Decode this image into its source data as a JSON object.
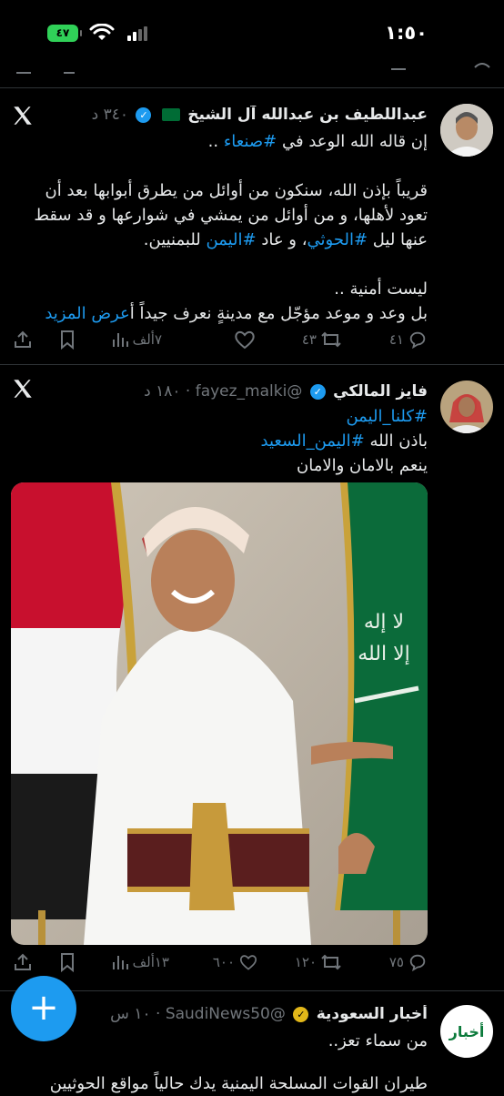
{
  "status_bar": {
    "time": "١:٥٠",
    "battery": "٤٧"
  },
  "tweets": [
    {
      "author": "عبداللطيف بن عبدالله آل الشيخ",
      "age": "٣٤٠ د",
      "lines": [
        "إن قاله الله الوعد في",
        "قريباً بإذن الله، سنكون من أوائل من يطرق أبوابها بعد أن",
        "تعود لأهلها، و من أوائل من يمشي في شوارعها و قد سقط",
        "عنها ليل",
        "، و عاد",
        "للبمنيين.",
        "ليست أمنية ..",
        "بل وعد و موعد مؤجّل مع مدينةٍ نعرف جيداً أ"
      ],
      "hashtags": [
        "#صنعاء",
        "#الحوثي",
        "#اليمن"
      ],
      "line1_suffix": " ..",
      "show_more": "عرض المزيد",
      "replies": "٤١",
      "retweets": "٤٣",
      "views": "٧ألف"
    },
    {
      "author": "فايز المالكي",
      "handle": "@fayez_malki",
      "age": "١٨٠ د",
      "hashtag1": "#كلنا_اليمن",
      "line2_prefix": "باذن الله ",
      "hashtag2": "#اليمن_السعيد",
      "line3": "ينعم بالامان والامان",
      "replies": "٧٥",
      "retweets": "١٢٠",
      "likes": "٦٠٠",
      "views": "١٣ألف"
    },
    {
      "author": "أخبار السعودية",
      "handle": "@SaudiNews50",
      "age": "١٠ س",
      "line1": "من سماء تعز..",
      "line2": "طيران القوات المسلحة اليمنية يدك حالياً مواقع الحوثيين",
      "avatar_text": "أخبار"
    }
  ],
  "colors": {
    "background": "#000000",
    "accent": "#1d9bf0",
    "muted": "#71767b",
    "divider": "#2f3336"
  },
  "icons": [
    "reply-icon",
    "retweet-icon",
    "like-icon",
    "views-icon",
    "bookmark-icon",
    "share-icon",
    "x-logo-icon",
    "compose-plus-icon"
  ]
}
